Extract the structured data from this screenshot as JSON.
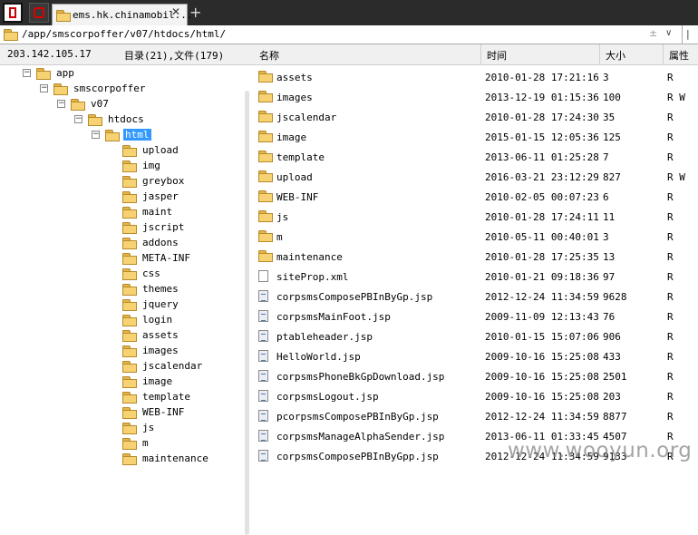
{
  "tab": {
    "title": "ems.hk.chinamobil..."
  },
  "address": {
    "path": "/app/smscorpoffer/v07/htdocs/html/"
  },
  "status": {
    "host": "203.142.105.17",
    "summary": "目录(21),文件(179)"
  },
  "columns": {
    "name": "名称",
    "time": "时间",
    "size": "大小",
    "attr": "属性"
  },
  "tree": [
    {
      "label": "app",
      "expander": "−"
    },
    {
      "label": "smscorpoffer",
      "expander": "−"
    },
    {
      "label": "v07",
      "expander": "−"
    },
    {
      "label": "htdocs",
      "expander": "−"
    },
    {
      "label": "html",
      "expander": "−",
      "selected": true
    },
    {
      "label": "upload"
    },
    {
      "label": "img"
    },
    {
      "label": "greybox"
    },
    {
      "label": "jasper"
    },
    {
      "label": "maint"
    },
    {
      "label": "jscript"
    },
    {
      "label": "addons"
    },
    {
      "label": "META-INF"
    },
    {
      "label": "css"
    },
    {
      "label": "themes"
    },
    {
      "label": "jquery"
    },
    {
      "label": "login"
    },
    {
      "label": "assets"
    },
    {
      "label": "images"
    },
    {
      "label": "jscalendar"
    },
    {
      "label": "image"
    },
    {
      "label": "template"
    },
    {
      "label": "WEB-INF"
    },
    {
      "label": "js"
    },
    {
      "label": "m"
    },
    {
      "label": "maintenance"
    }
  ],
  "files": [
    {
      "type": "folder",
      "name": "assets",
      "time": "2010-01-28 17:21:16",
      "size": "3",
      "attr": "R"
    },
    {
      "type": "folder",
      "name": "images",
      "time": "2013-12-19 01:15:36",
      "size": "100",
      "attr": "R W"
    },
    {
      "type": "folder",
      "name": "jscalendar",
      "time": "2010-01-28 17:24:30",
      "size": "35",
      "attr": "R"
    },
    {
      "type": "folder",
      "name": "image",
      "time": "2015-01-15 12:05:36",
      "size": "125",
      "attr": "R"
    },
    {
      "type": "folder",
      "name": "template",
      "time": "2013-06-11 01:25:28",
      "size": "7",
      "attr": "R"
    },
    {
      "type": "folder",
      "name": "upload",
      "time": "2016-03-21 23:12:29",
      "size": "827",
      "attr": "R W"
    },
    {
      "type": "folder",
      "name": "WEB-INF",
      "time": "2010-02-05 00:07:23",
      "size": "6",
      "attr": "R"
    },
    {
      "type": "folder",
      "name": "js",
      "time": "2010-01-28 17:24:11",
      "size": "11",
      "attr": "R"
    },
    {
      "type": "folder",
      "name": "m",
      "time": "2010-05-11 00:40:01",
      "size": "3",
      "attr": "R"
    },
    {
      "type": "folder",
      "name": "maintenance",
      "time": "2010-01-28 17:25:35",
      "size": "13",
      "attr": "R"
    },
    {
      "type": "file",
      "name": "siteProp.xml",
      "time": "2010-01-21 09:18:36",
      "size": "97",
      "attr": "R"
    },
    {
      "type": "jsp",
      "name": "corpsmsComposePBInByGp.jsp",
      "time": "2012-12-24 11:34:59",
      "size": "9628",
      "attr": "R"
    },
    {
      "type": "jsp",
      "name": "corpsmsMainFoot.jsp",
      "time": "2009-11-09 12:13:43",
      "size": "76",
      "attr": "R"
    },
    {
      "type": "jsp",
      "name": "ptableheader.jsp",
      "time": "2010-01-15 15:07:06",
      "size": "906",
      "attr": "R"
    },
    {
      "type": "jsp",
      "name": "HelloWorld.jsp",
      "time": "2009-10-16 15:25:08",
      "size": "433",
      "attr": "R"
    },
    {
      "type": "jsp",
      "name": "corpsmsPhoneBkGpDownload.jsp",
      "time": "2009-10-16 15:25:08",
      "size": "2501",
      "attr": "R"
    },
    {
      "type": "jsp",
      "name": "corpsmsLogout.jsp",
      "time": "2009-10-16 15:25:08",
      "size": "203",
      "attr": "R"
    },
    {
      "type": "jsp",
      "name": "pcorpsmsComposePBInByGp.jsp",
      "time": "2012-12-24 11:34:59",
      "size": "8877",
      "attr": "R"
    },
    {
      "type": "jsp",
      "name": "corpsmsManageAlphaSender.jsp",
      "time": "2013-06-11 01:33:45",
      "size": "4507",
      "attr": "R"
    },
    {
      "type": "jsp",
      "name": "corpsmsComposePBInByGpp.jsp",
      "time": "2012-12-24 11:34:59",
      "size": "9133",
      "attr": "R"
    }
  ],
  "watermark": "www.wooyun.org",
  "icons": {
    "folder": "folder-icon",
    "file": "file-icon",
    "jsp": "jsp-file-icon"
  }
}
